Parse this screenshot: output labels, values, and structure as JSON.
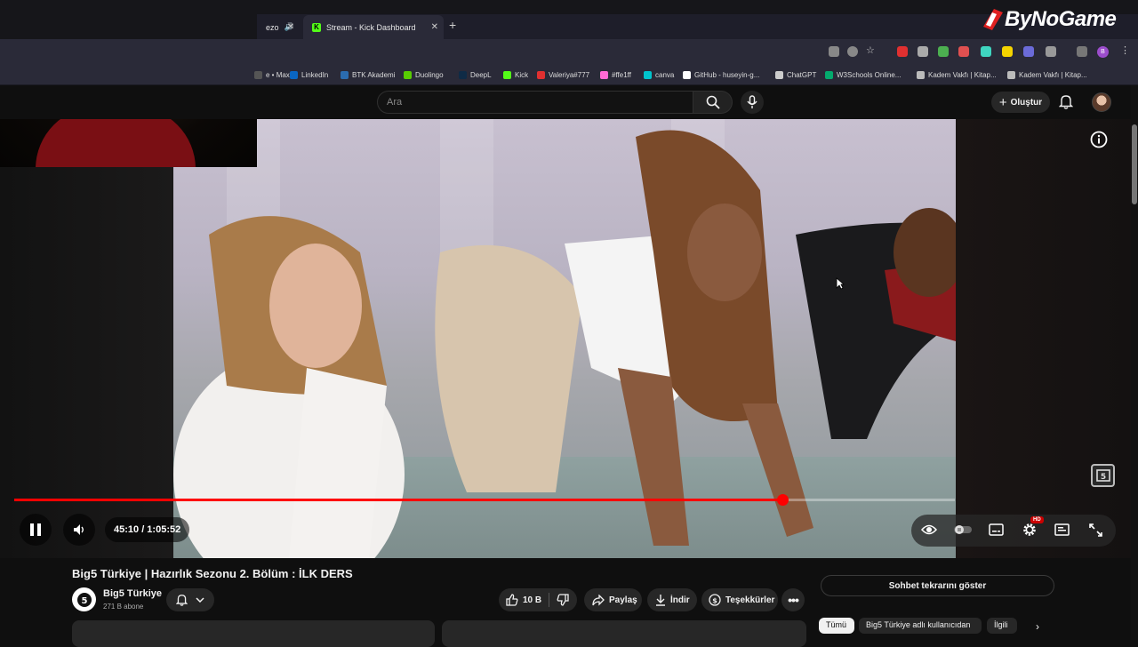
{
  "watermark": {
    "text": "ByNoGame"
  },
  "browser": {
    "tabs": [
      {
        "label": "ezo",
        "audio": true
      },
      {
        "label": "Stream - Kick Dashboard",
        "icon": "kick-icon"
      }
    ],
    "bookmarks": [
      {
        "label": "e • Max",
        "color": "#555"
      },
      {
        "label": "LinkedIn",
        "color": "#0a66c2"
      },
      {
        "label": "BTK Akademi",
        "color": "#2b6cb0"
      },
      {
        "label": "Duolingo",
        "color": "#58cc02"
      },
      {
        "label": "DeepL",
        "color": "#0f2b46"
      },
      {
        "label": "Kick",
        "color": "#53fc18"
      },
      {
        "label": "Valeriya#777",
        "color": "#e03030"
      },
      {
        "label": "#ffe1ff",
        "color": "#ff6ad5"
      },
      {
        "label": "canva",
        "color": "#00c4cc"
      },
      {
        "label": "GitHub - huseyin-g...",
        "color": "#ffffff"
      },
      {
        "label": "ChatGPT",
        "color": "#cccccc"
      },
      {
        "label": "W3Schools Online...",
        "color": "#04aa6d"
      },
      {
        "label": "Kadem Vakfı | Kitap...",
        "color": "#bbbbbb"
      },
      {
        "label": "Kadem Vakfı | Kitap...",
        "color": "#bbbbbb"
      }
    ]
  },
  "youtube": {
    "search_placeholder": "Ara",
    "create_label": "Oluştur"
  },
  "player": {
    "current_time": "45:10",
    "duration": "1:05:52",
    "time_display": "45:10 / 1:05:52",
    "progress_fraction": 0.8163,
    "hd_badge": "HD"
  },
  "video": {
    "title": "Big5 Türkiye | Hazırlık Sezonu 2. Bölüm : İLK DERS",
    "channel_name": "Big5 Türkiye",
    "subscribers": "271 B abone",
    "likes": "10 B",
    "share_label": "Paylaş",
    "download_label": "İndir",
    "thanks_label": "Teşekkürler"
  },
  "sidebar": {
    "chat_replay_label": "Sohbet tekrarını göster",
    "chips": [
      {
        "label": "Tümü",
        "active": true
      },
      {
        "label": "Big5 Türkiye adlı kullanıcıdan",
        "active": false
      },
      {
        "label": "İlgili",
        "active": false
      }
    ]
  },
  "colors": {
    "progress": "#ff0000",
    "background": "#0f0f0f",
    "accent_badge": "#cc0000"
  }
}
